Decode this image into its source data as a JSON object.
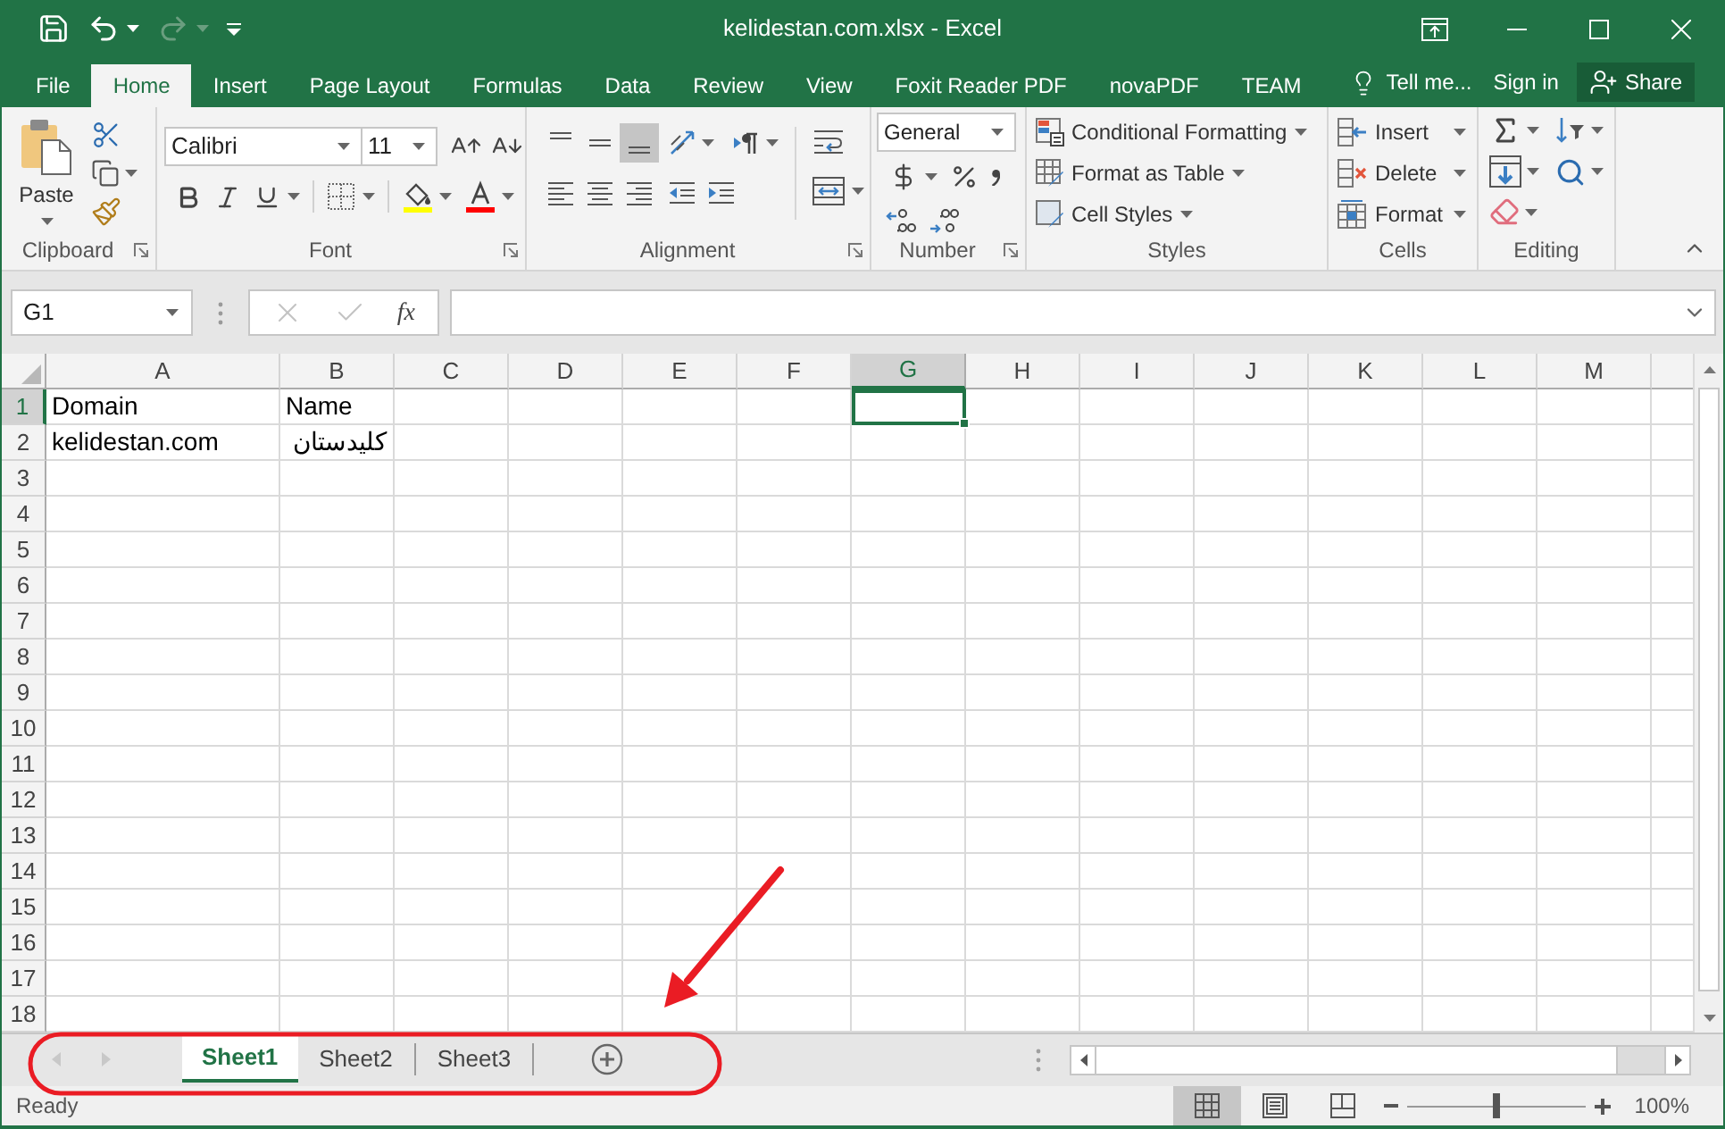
{
  "window": {
    "title": "kelidestan.com.xlsx - Excel"
  },
  "quick_access": [
    {
      "kind": "save",
      "disabled": false
    },
    {
      "kind": "undo",
      "disabled": false
    },
    {
      "kind": "redo",
      "disabled": true
    },
    {
      "kind": "customize",
      "disabled": false
    }
  ],
  "ribbon_tabs": [
    {
      "label": "File",
      "selected": false
    },
    {
      "label": "Home",
      "selected": true
    },
    {
      "label": "Insert",
      "selected": false
    },
    {
      "label": "Page Layout",
      "selected": false
    },
    {
      "label": "Formulas",
      "selected": false
    },
    {
      "label": "Data",
      "selected": false
    },
    {
      "label": "Review",
      "selected": false
    },
    {
      "label": "View",
      "selected": false
    },
    {
      "label": "Foxit Reader PDF",
      "selected": false
    },
    {
      "label": "novaPDF",
      "selected": false
    },
    {
      "label": "TEAM",
      "selected": false
    }
  ],
  "tell_me": "Tell me...",
  "sign_in": "Sign in",
  "share": "Share",
  "ribbon": {
    "clipboard": {
      "label": "Clipboard",
      "paste": "Paste"
    },
    "font": {
      "label": "Font",
      "name": "Calibri",
      "size": "11"
    },
    "alignment": {
      "label": "Alignment",
      "vertical": [
        {
          "kind": "top",
          "selected": false
        },
        {
          "kind": "middle",
          "selected": false
        },
        {
          "kind": "bottom",
          "selected": true
        }
      ],
      "horizontal": [
        {
          "kind": "left",
          "selected": false
        },
        {
          "kind": "center",
          "selected": false
        },
        {
          "kind": "right",
          "selected": false
        }
      ]
    },
    "number": {
      "label": "Number",
      "format": "General"
    },
    "styles": {
      "label": "Styles",
      "buttons": [
        {
          "kind": "conditional_formatting",
          "label": "Conditional Formatting"
        },
        {
          "kind": "format_as_table",
          "label": "Format as Table"
        },
        {
          "kind": "cell_styles",
          "label": "Cell Styles"
        }
      ]
    },
    "cells": {
      "label": "Cells",
      "buttons": [
        {
          "kind": "insert",
          "label": "Insert"
        },
        {
          "kind": "delete",
          "label": "Delete"
        },
        {
          "kind": "format",
          "label": "Format"
        }
      ]
    },
    "editing": {
      "label": "Editing"
    }
  },
  "formula_bar": {
    "name_box": "G1",
    "buttons": [
      {
        "kind": "cancel",
        "disabled": true
      },
      {
        "kind": "enter",
        "disabled": true
      }
    ],
    "function_label": "fx"
  },
  "sheet": {
    "columns": [
      {
        "label": "A",
        "selected": false
      },
      {
        "label": "B",
        "selected": false
      },
      {
        "label": "C",
        "selected": false
      },
      {
        "label": "D",
        "selected": false
      },
      {
        "label": "E",
        "selected": false
      },
      {
        "label": "F",
        "selected": false
      },
      {
        "label": "G",
        "selected": true
      },
      {
        "label": "H",
        "selected": false
      },
      {
        "label": "I",
        "selected": false
      },
      {
        "label": "J",
        "selected": false
      },
      {
        "label": "K",
        "selected": false
      },
      {
        "label": "L",
        "selected": false
      },
      {
        "label": "M",
        "selected": false
      }
    ],
    "rows": [
      {
        "label": "1",
        "selected": true,
        "cells": [
          "Domain",
          "Name"
        ]
      },
      {
        "label": "2",
        "selected": false,
        "cells": [
          "kelidestan.com",
          "کلیدستان"
        ]
      },
      {
        "label": "3",
        "selected": false
      },
      {
        "label": "4",
        "selected": false
      },
      {
        "label": "5",
        "selected": false
      },
      {
        "label": "6",
        "selected": false
      },
      {
        "label": "7",
        "selected": false
      },
      {
        "label": "8",
        "selected": false
      },
      {
        "label": "9",
        "selected": false
      },
      {
        "label": "10",
        "selected": false
      },
      {
        "label": "11",
        "selected": false
      },
      {
        "label": "12",
        "selected": false
      },
      {
        "label": "13",
        "selected": false
      },
      {
        "label": "14",
        "selected": false
      },
      {
        "label": "15",
        "selected": false
      },
      {
        "label": "16",
        "selected": false
      },
      {
        "label": "17",
        "selected": false
      },
      {
        "label": "18",
        "selected": false
      }
    ]
  },
  "sheet_navigation": [
    {
      "kind": "previous",
      "disabled": true
    },
    {
      "kind": "next",
      "disabled": true
    }
  ],
  "sheet_tabs": [
    {
      "label": "Sheet1",
      "selected": true
    },
    {
      "label": "Sheet2",
      "selected": false
    },
    {
      "label": "Sheet3",
      "selected": false
    }
  ],
  "status_bar": {
    "status": "Ready",
    "views": [
      {
        "kind": "normal",
        "selected": true
      },
      {
        "kind": "page_layout",
        "selected": false
      },
      {
        "kind": "page_break",
        "selected": false
      }
    ],
    "zoom": {
      "level": 0.5,
      "reading": "100%"
    }
  }
}
